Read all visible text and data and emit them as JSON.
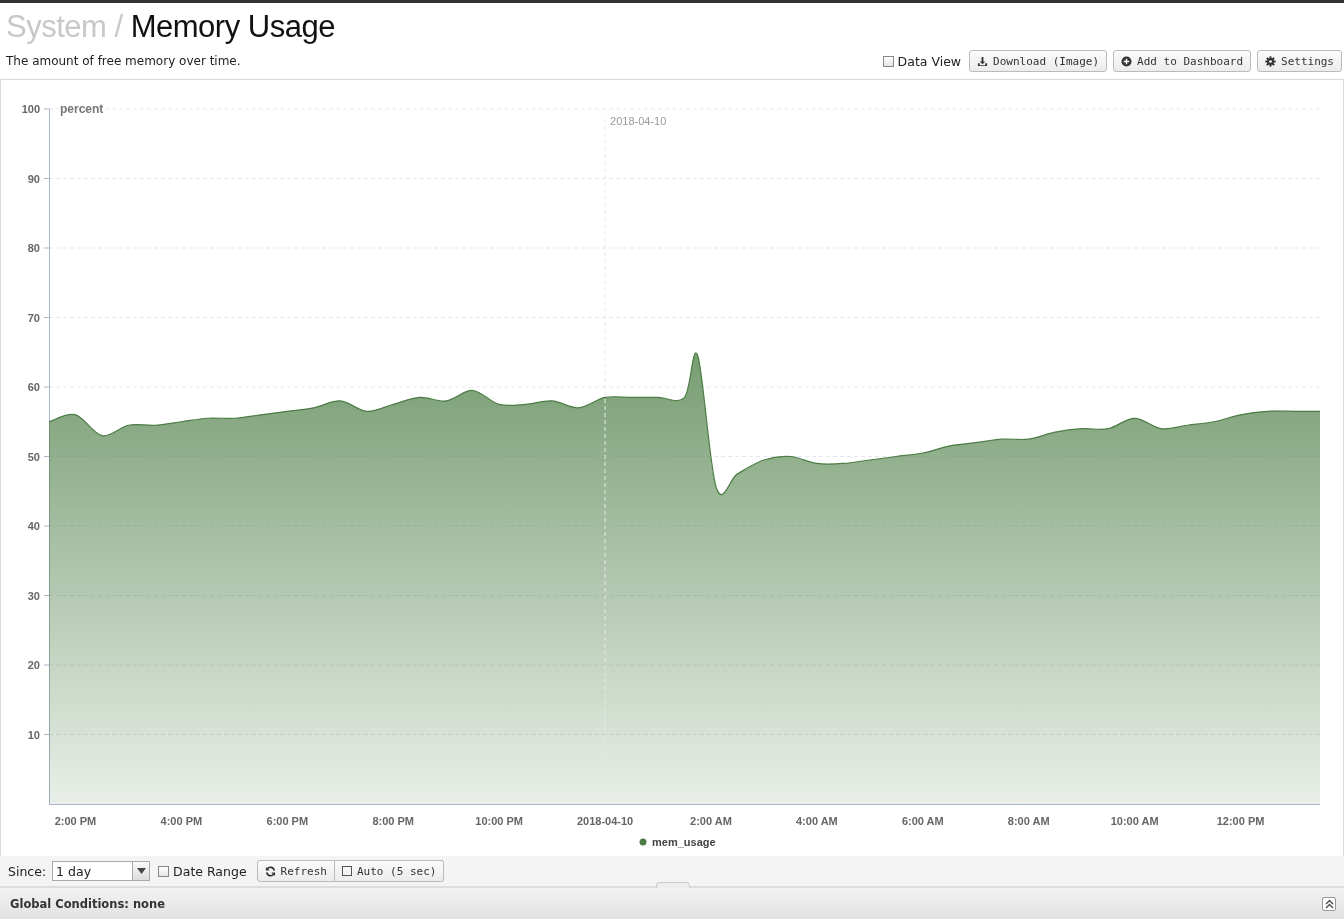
{
  "header": {
    "breadcrumb": "System /",
    "title": "Memory Usage",
    "description": "The amount of free memory over time."
  },
  "toolbar": {
    "data_view": {
      "label": "Data View",
      "checked": false
    },
    "buttons": [
      {
        "label": "Download (Image)",
        "kind": "download"
      },
      {
        "label": "Add to Dashboard",
        "kind": "add"
      },
      {
        "label": "Settings",
        "kind": "settings"
      }
    ]
  },
  "chart": {
    "chart_data": {
      "type": "area",
      "ylabel": "percent",
      "x": [
        "2018-04-09T13:30",
        "2018-04-09T14:00",
        "2018-04-09T14:30",
        "2018-04-09T15:00",
        "2018-04-09T15:30",
        "2018-04-09T16:00",
        "2018-04-09T16:30",
        "2018-04-09T17:00",
        "2018-04-09T17:30",
        "2018-04-09T18:00",
        "2018-04-09T18:30",
        "2018-04-09T19:00",
        "2018-04-09T19:30",
        "2018-04-09T20:00",
        "2018-04-09T20:30",
        "2018-04-09T21:00",
        "2018-04-09T21:30",
        "2018-04-09T22:00",
        "2018-04-09T22:30",
        "2018-04-09T23:00",
        "2018-04-09T23:30",
        "2018-04-10T00:00",
        "2018-04-10T00:30",
        "2018-04-10T01:00",
        "2018-04-10T01:30",
        "2018-04-10T01:45",
        "2018-04-10T02:06",
        "2018-04-10T02:30",
        "2018-04-10T03:00",
        "2018-04-10T03:30",
        "2018-04-10T04:00",
        "2018-04-10T04:30",
        "2018-04-10T05:00",
        "2018-04-10T05:30",
        "2018-04-10T06:00",
        "2018-04-10T06:30",
        "2018-04-10T07:00",
        "2018-04-10T07:30",
        "2018-04-10T08:00",
        "2018-04-10T08:30",
        "2018-04-10T09:00",
        "2018-04-10T09:30",
        "2018-04-10T10:00",
        "2018-04-10T10:30",
        "2018-04-10T11:00",
        "2018-04-10T11:30",
        "2018-04-10T12:00",
        "2018-04-10T12:30",
        "2018-04-10T13:00",
        "2018-04-10T13:30"
      ],
      "series": [
        {
          "name": "mem_usage",
          "color": "#4a7c43",
          "values": [
            55,
            56,
            53,
            54.5,
            54.5,
            55,
            55.5,
            55.5,
            56,
            56.5,
            57,
            58,
            56.5,
            57.5,
            58.5,
            58,
            59.5,
            57.5,
            57.5,
            58,
            57,
            58.5,
            58.5,
            58.5,
            58.5,
            64.5,
            45.5,
            47.5,
            49.5,
            50,
            49,
            49,
            49.5,
            50,
            50.5,
            51.5,
            52,
            52.5,
            52.5,
            53.5,
            54,
            54,
            55.5,
            54,
            54.5,
            55,
            56,
            56.5,
            56.5,
            56.5
          ]
        }
      ],
      "xlim": [
        "2018-04-09T13:30",
        "2018-04-10T13:30"
      ],
      "ylim": [
        0,
        100
      ],
      "xticks": [
        {
          "value": "2018-04-09T14:00",
          "label": "2:00 PM"
        },
        {
          "value": "2018-04-09T16:00",
          "label": "4:00 PM"
        },
        {
          "value": "2018-04-09T18:00",
          "label": "6:00 PM"
        },
        {
          "value": "2018-04-09T20:00",
          "label": "8:00 PM"
        },
        {
          "value": "2018-04-09T22:00",
          "label": "10:00 PM"
        },
        {
          "value": "2018-04-10T00:00",
          "label": "2018-04-10"
        },
        {
          "value": "2018-04-10T02:00",
          "label": "2:00 AM"
        },
        {
          "value": "2018-04-10T04:00",
          "label": "4:00 AM"
        },
        {
          "value": "2018-04-10T06:00",
          "label": "6:00 AM"
        },
        {
          "value": "2018-04-10T08:00",
          "label": "8:00 AM"
        },
        {
          "value": "2018-04-10T10:00",
          "label": "10:00 AM"
        },
        {
          "value": "2018-04-10T12:00",
          "label": "12:00 PM"
        }
      ],
      "yticks": [
        10,
        20,
        30,
        40,
        50,
        60,
        70,
        80,
        90,
        100
      ],
      "grid": true,
      "ref_lines": [
        {
          "axis": "x",
          "value": "2018-04-10T00:00",
          "label": "2018-04-10"
        }
      ]
    }
  },
  "controls": {
    "since_label": "Since:",
    "since": {
      "value": "1 day"
    },
    "date_range": {
      "label": "Date Range",
      "checked": false
    },
    "refresh": {
      "label": "Refresh"
    },
    "auto": {
      "label": "Auto (5 sec)",
      "checked": false
    }
  },
  "global_conditions": {
    "text": "Global Conditions: none",
    "expanded": false
  }
}
